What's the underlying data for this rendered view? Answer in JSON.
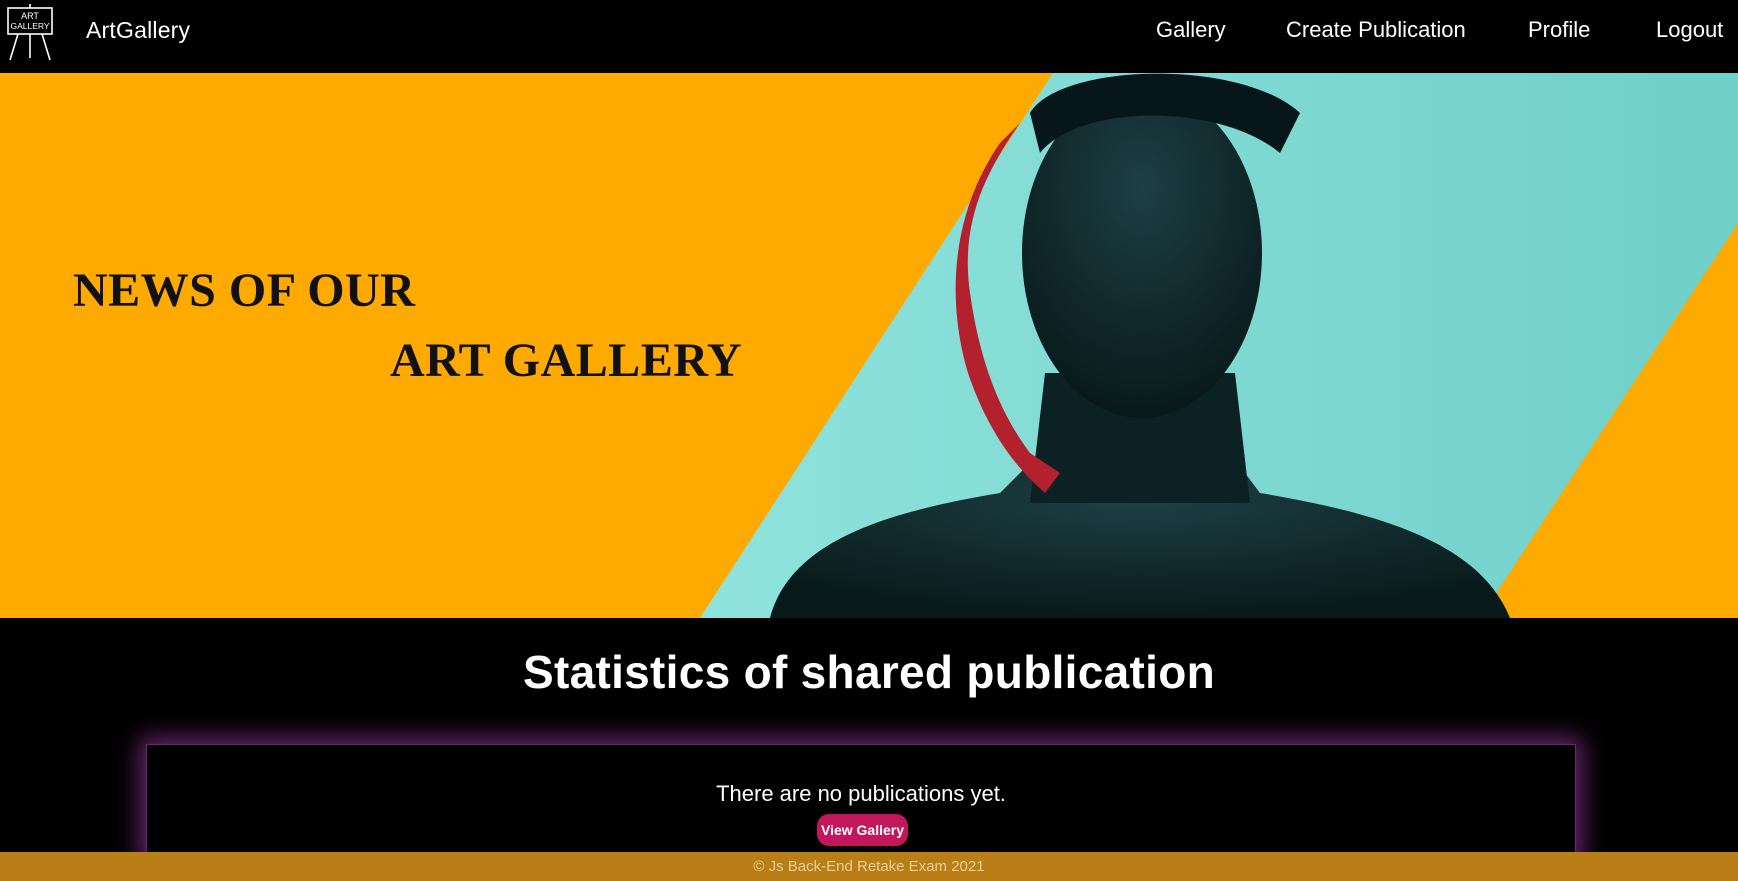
{
  "header": {
    "logo_icon": "easel-logo-icon",
    "logo_text_line1": "ART",
    "logo_text_line2": "GALLERY",
    "brand": "ArtGallery",
    "nav": {
      "gallery": "Gallery",
      "create": "Create Publication",
      "profile": "Profile",
      "logout": "Logout"
    }
  },
  "hero": {
    "line1": "NEWS OF OUR",
    "line2": "ART GALLERY",
    "colors": {
      "background": "#ffaa00",
      "panel": "#7fd8d2",
      "figure": "#0e2a2d",
      "ribbon": "#b3202e"
    }
  },
  "stats": {
    "title": "Statistics of shared publication",
    "empty_message": "There are no publications yet.",
    "button_label": "View Gallery",
    "button_color": "#c2185b",
    "glow_color": "#be46c8"
  },
  "footer": {
    "text": "© Js Back-End Retake Exam 2021"
  }
}
